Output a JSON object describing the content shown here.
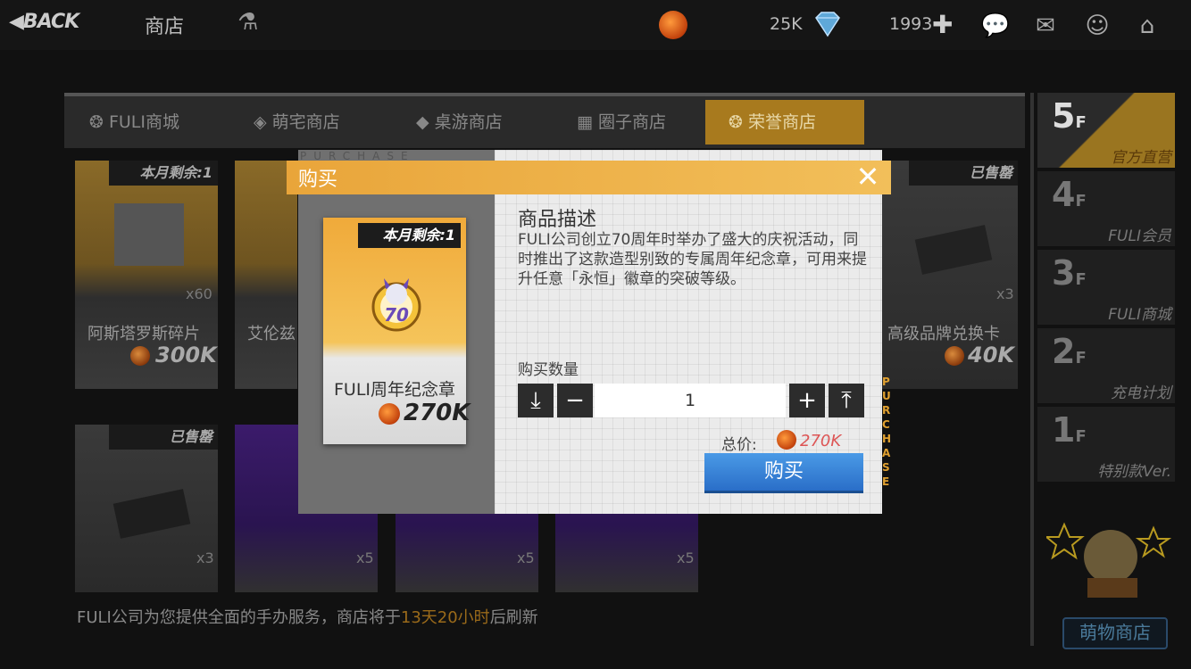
{
  "topbar": {
    "back_label": "BACK",
    "title": "商店",
    "currency_a": "25K",
    "currency_b": "1993"
  },
  "tabs": [
    {
      "label": "FULI商城"
    },
    {
      "label": "萌宅商店"
    },
    {
      "label": "桌游商店"
    },
    {
      "label": "圈子商店"
    },
    {
      "label": "荣誉商店",
      "active": true
    }
  ],
  "cards_row1": [
    {
      "tag": "本月剩余:1",
      "count": "x60",
      "name": "阿斯塔罗斯碎片",
      "price": "300K"
    },
    {
      "tag": "",
      "count": "",
      "name": "艾伦兹",
      "price": ""
    },
    {
      "tag": "已售罄",
      "count": "x3",
      "name": "高级品牌兑换卡",
      "price": "40K"
    }
  ],
  "cards_row2": [
    {
      "tag": "已售罄",
      "count": "x3"
    },
    {
      "tag": "",
      "count": "x5"
    },
    {
      "tag": "",
      "count": "x5"
    },
    {
      "tag": "",
      "count": "x5"
    }
  ],
  "footer": {
    "prefix": "FULI公司为您提供全面的手办服务，商店将于",
    "highlight": "13天20小时",
    "suffix": "后刷新"
  },
  "floors": [
    {
      "num": "5",
      "label": "官方直营",
      "active": true
    },
    {
      "num": "4",
      "label": "FULI会员"
    },
    {
      "num": "3",
      "label": "FULI商城"
    },
    {
      "num": "2",
      "label": "充电计划"
    },
    {
      "num": "1",
      "label": "特别款Ver."
    }
  ],
  "floor_suffix": "F",
  "mascot_label": "萌物商店",
  "modal": {
    "title": "购买",
    "watermark": "PURCHASE",
    "item_tag": "本月剩余:1",
    "item_name": "FULI周年纪念章",
    "item_price": "270K",
    "medal_number": "70",
    "desc_title": "商品描述",
    "desc_text": "FULI公司创立70周年时举办了盛大的庆祝活动，同时推出了这款造型别致的专属周年纪念章，可用来提升任意「永恒」徽章的突破等级。",
    "qty_label": "购买数量",
    "qty_value": "1",
    "total_label": "总价:",
    "total_value": "270K",
    "buy_label": "购买",
    "side_text": "PURCHASE"
  },
  "colors": {
    "accent": "#f0a836",
    "buy_button": "#3a86d8",
    "total_price": "#dd5555"
  }
}
